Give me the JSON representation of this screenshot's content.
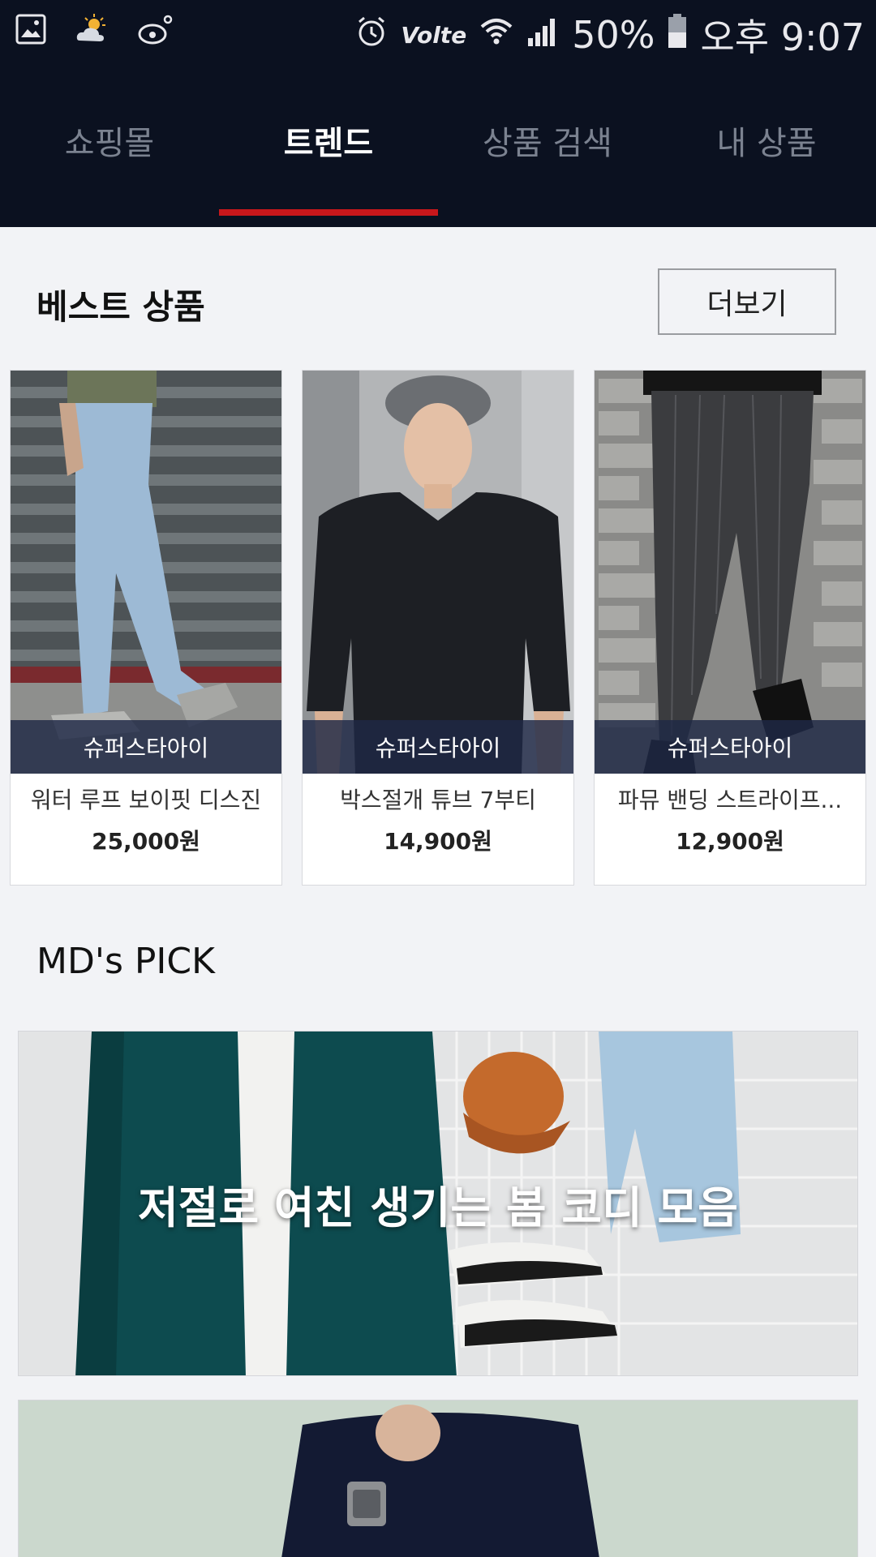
{
  "status_bar": {
    "icons_left": [
      "gallery-icon",
      "weather-icon",
      "weibo-icon"
    ],
    "icons_right": [
      "alarm-icon",
      "volte-icon",
      "wifi-icon",
      "signal-icon",
      "battery-icon"
    ],
    "volte_label": "Volte",
    "battery": "50%",
    "time": "오후 9:07"
  },
  "tabs": [
    {
      "label": "쇼핑몰",
      "active": false
    },
    {
      "label": "트렌드",
      "active": true
    },
    {
      "label": "상품 검색",
      "active": false
    },
    {
      "label": "내 상품",
      "active": false
    }
  ],
  "best": {
    "title": "베스트 상품",
    "more_label": "더보기",
    "products": [
      {
        "store": "슈퍼스타아이",
        "name": "워터 루프 보이핏 디스진",
        "price": "25,000원"
      },
      {
        "store": "슈퍼스타아이",
        "name": "박스절개 튜브 7부티",
        "price": "14,900원"
      },
      {
        "store": "슈퍼스타아이",
        "name": "파뮤 밴딩 스트라이프...",
        "price": "12,900원"
      }
    ]
  },
  "md_pick": {
    "title": "MD's PICK",
    "banners": [
      {
        "text": "저절로 여친 생기는 봄 코디 모음"
      },
      {
        "text": ""
      }
    ]
  },
  "colors": {
    "header_bg": "#0b1120",
    "tab_indicator": "#c8171b",
    "page_bg": "#f2f3f6"
  }
}
